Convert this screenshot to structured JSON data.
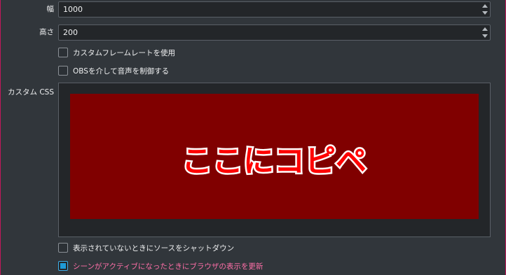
{
  "fields": {
    "width": {
      "label": "幅",
      "value": "1000"
    },
    "height": {
      "label": "高さ",
      "value": "200"
    }
  },
  "checkboxes": {
    "custom_framerate": {
      "label": "カスタムフレームレートを使用",
      "checked": false
    },
    "obs_audio": {
      "label": "OBSを介して音声を制御する",
      "checked": false
    }
  },
  "custom_css": {
    "label": "カスタム CSS",
    "image_text": "ここにコピペ",
    "image_bg_color": "#800000",
    "image_text_color": "#ff0000"
  },
  "bottom_checkboxes": {
    "shutdown_hidden": {
      "label": "表示されていないときにソースをシャットダウン",
      "checked": false
    },
    "refresh_active": {
      "label": "シーンがアクティブになったときにブラウザの表示を更新",
      "checked": true
    }
  },
  "colors": {
    "background": "#31363b",
    "input_bg": "#232629",
    "accent_blue": "#3daee9",
    "accent_pink": "#ff6fa8",
    "edge_magenta": "#c2185b"
  }
}
